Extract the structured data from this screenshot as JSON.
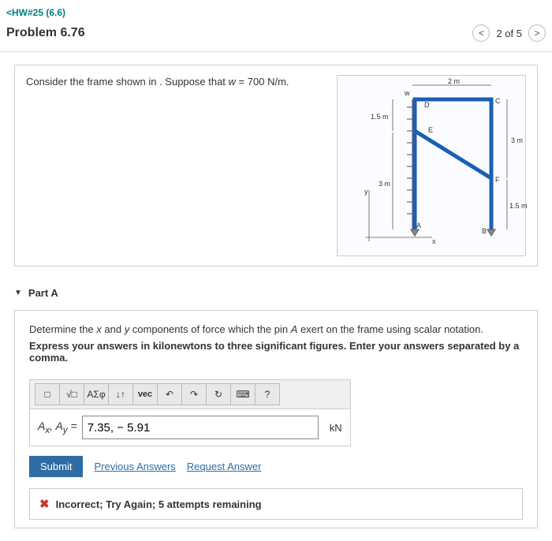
{
  "breadcrumb": {
    "label": "HW#25 (6.6)"
  },
  "title": "Problem 6.76",
  "pager": {
    "count": "2 of 5"
  },
  "problem": {
    "prompt_pre": "Consider the frame shown in . Suppose that ",
    "var": "w",
    "eq": " = 700 ",
    "unit": "N/m",
    "post": "."
  },
  "figure": {
    "w": "w",
    "D": "D",
    "C": "C",
    "E": "E",
    "F": "F",
    "A": "A",
    "B": "B",
    "x": "x",
    "y": "y",
    "d2m": "2 m",
    "d15m_top": "1.5 m",
    "d3m_left": "3 m",
    "d3m_right": "3 m",
    "d15m_right": "1.5 m"
  },
  "partA": {
    "title": "Part A",
    "q1_a": "Determine the ",
    "q1_x": "x",
    "q1_b": " and ",
    "q1_y": "y",
    "q1_c": " components of force which the pin ",
    "q1_A": "A",
    "q1_d": " exert on the frame using scalar notation.",
    "q2": "Express your answers in kilonewtons to three significant figures. Enter your answers separated by a comma.",
    "toolbar": {
      "tmpl": "□",
      "sqrt": "√□",
      "greek": "ΑΣφ",
      "arrows": "↓↑",
      "vec": "vec",
      "undo": "↶",
      "redo": "↷",
      "reset": "↻",
      "kbd": "⌨",
      "help": "?"
    },
    "lhs_a": "A",
    "lhs_x": "x",
    "lhs_y": "y",
    "lhs_eq": " = ",
    "answer_value": "7.35, − 5.91",
    "unit": "kN",
    "submit": "Submit",
    "prev_link": "Previous Answers",
    "req_link": "Request Answer",
    "feedback": "Incorrect; Try Again; 5 attempts remaining"
  }
}
